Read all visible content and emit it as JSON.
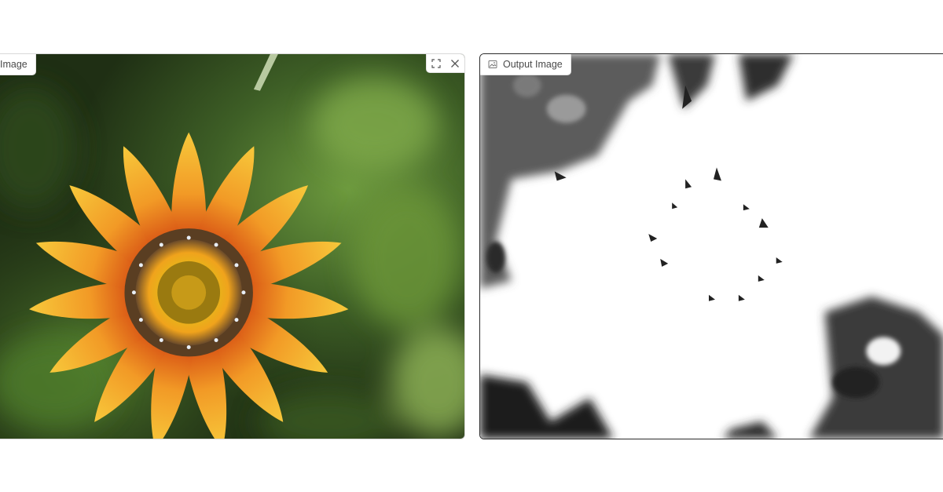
{
  "input_panel": {
    "label": "Image",
    "label_icon": "image-icon",
    "tools": [
      {
        "name": "fullscreen",
        "icon": "fullscreen-icon"
      },
      {
        "name": "clear",
        "icon": "close-icon"
      }
    ]
  },
  "output_panel": {
    "label": "Output Image",
    "label_icon": "image-icon"
  },
  "colors": {
    "background": "#ffffff",
    "panel_border": "#d9d9d9",
    "label_text": "#4a4a4a"
  }
}
